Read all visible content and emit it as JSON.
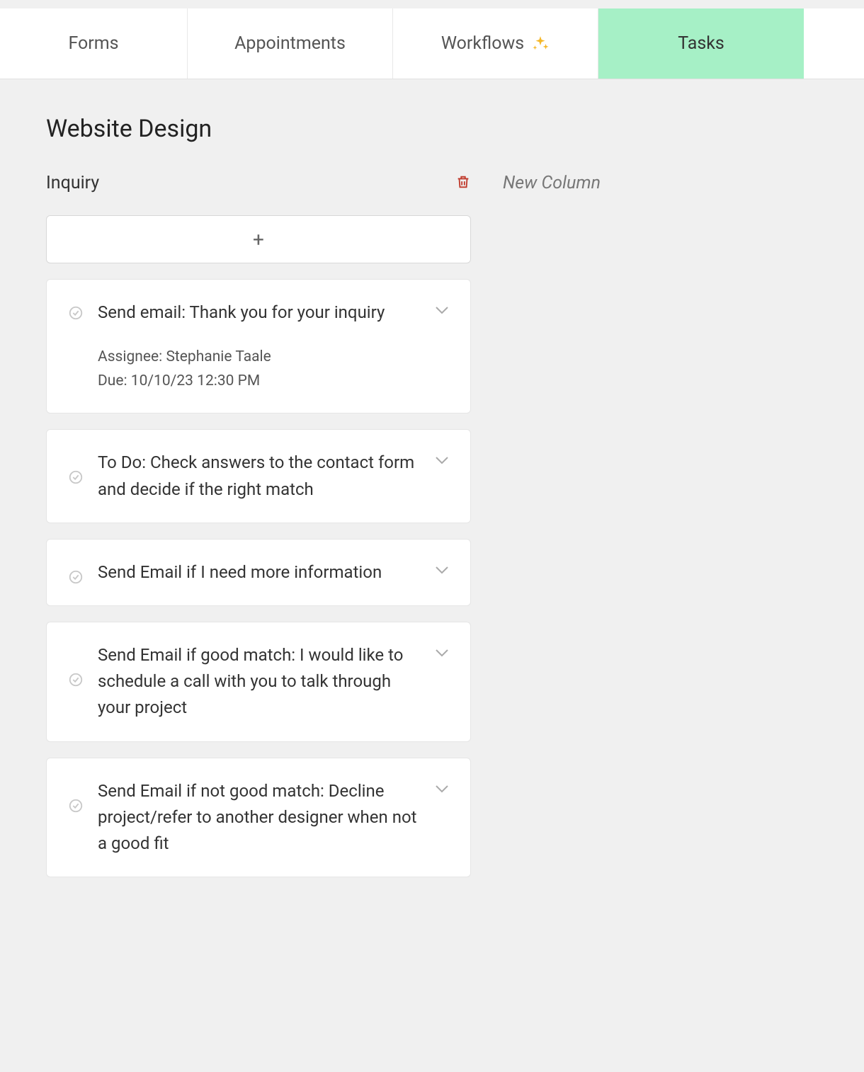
{
  "tabs": [
    {
      "label": "Forms",
      "active": false,
      "hasSparkle": false
    },
    {
      "label": "Appointments",
      "active": false,
      "hasSparkle": false
    },
    {
      "label": "Workflows",
      "active": false,
      "hasSparkle": true
    },
    {
      "label": "Tasks",
      "active": true,
      "hasSparkle": false
    }
  ],
  "page_title": "Website Design",
  "columns": [
    {
      "title": "Inquiry",
      "cards": [
        {
          "title": "Send email: Thank you for your inquiry",
          "assignee_label": "Assignee: Stephanie Taale",
          "due_label": "Due: 10/10/23 12:30 PM",
          "expanded": true
        },
        {
          "title": "To Do: Check answers to the contact form and decide if the right match",
          "expanded": false
        },
        {
          "title": "Send Email if I need more information",
          "expanded": false
        },
        {
          "title": "Send Email if good match: I would like to schedule a call with you to talk through your project",
          "expanded": false
        },
        {
          "title": "Send Email if not good match: Decline project/refer to another designer when not a good fit",
          "expanded": false
        }
      ]
    }
  ],
  "new_column_label": "New Column",
  "add_card_label": "+"
}
